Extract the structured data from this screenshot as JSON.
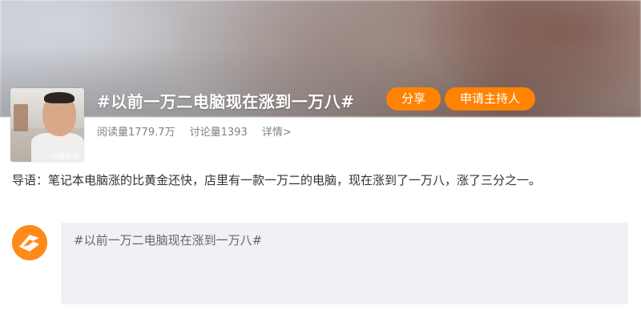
{
  "topic": {
    "title": "#以前一万二电脑现在涨到一万八#",
    "share_label": "分享",
    "apply_host_label": "申请主持人",
    "stats": {
      "reads": "阅读量1779.7万",
      "discussions": "讨论量1393",
      "details": "详情>"
    },
    "avatar_watermark": "中国新闻"
  },
  "intro": {
    "text": "导语：笔记本电脑涨的比黄金还快，店里有一款一万二的电脑，现在涨到了一万八，涨了三分之一。"
  },
  "composer": {
    "prefill": "#以前一万二电脑现在涨到一万八#",
    "avatar_icon": "weibo-user-avatar-icon"
  },
  "colors": {
    "accent": "#ff8200",
    "text_primary": "#333333",
    "text_secondary": "#808080",
    "composer_bg": "#f0f1f4"
  }
}
